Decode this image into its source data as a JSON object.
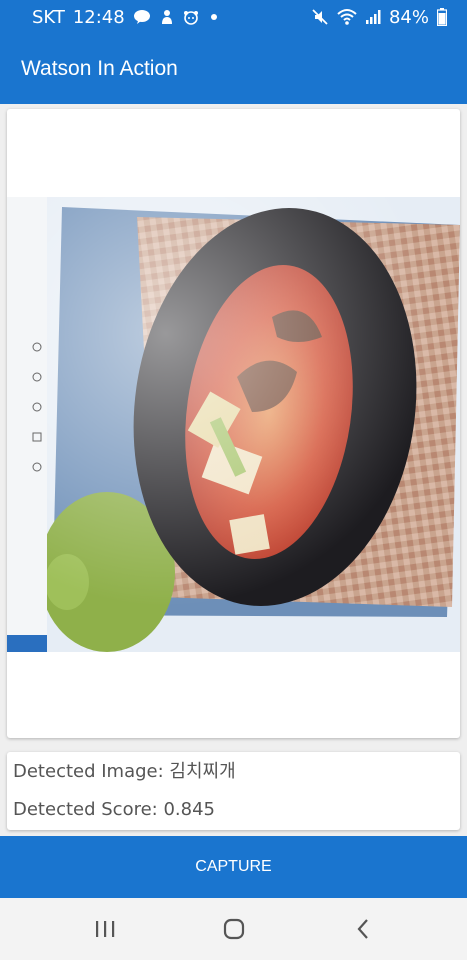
{
  "status_bar": {
    "carrier": "SKT",
    "time": "12:48",
    "notification_icons": [
      "talk-icon",
      "person-icon",
      "bear-icon"
    ],
    "battery": "84%"
  },
  "app": {
    "title": "Watson In Action"
  },
  "result": {
    "image_label": "Detected Image: 김치찌개",
    "score_label": "Detected Score: 0.845"
  },
  "capture_label": "CAPTURE",
  "nav": {
    "recents": "recents-icon",
    "home": "home-icon",
    "back": "back-icon"
  },
  "colors": {
    "primary": "#1a75cf",
    "background": "#efefef",
    "text": "#555555"
  }
}
